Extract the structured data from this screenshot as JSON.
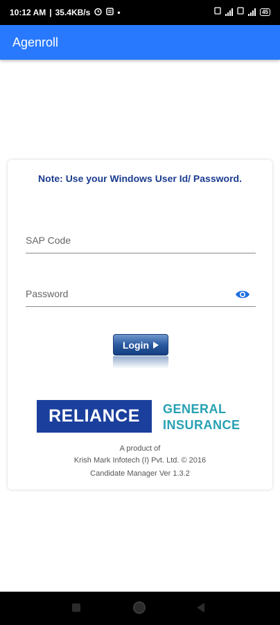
{
  "status_bar": {
    "time": "10:12 AM",
    "speed": "35.4KB/s",
    "battery": "45",
    "icons": [
      "alarm-icon",
      "notification-icon",
      "dot-icon",
      "sim-icon",
      "signal-icon",
      "wifi-icon",
      "battery-icon"
    ]
  },
  "app_bar": {
    "title": "Agenroll"
  },
  "login": {
    "note": "Note: Use your Windows User Id/ Password.",
    "sap_label": "SAP Code",
    "password_label": "Password",
    "login_button": "Login"
  },
  "branding": {
    "logo_main": "RELIANCE",
    "logo_line1": "GENERAL",
    "logo_line2": "INSURANCE",
    "logo_color": "#1b3f9c",
    "logo_accent": "#27a1b3"
  },
  "footer": {
    "line1": "A product of",
    "line2": "Krish Mark Infotech (I) Pvt. Ltd. © 2016",
    "line3": "Candidate Manager Ver 1.3.2"
  },
  "colors": {
    "app_bar": "#2979ff",
    "note_text": "#1a3c8f"
  }
}
